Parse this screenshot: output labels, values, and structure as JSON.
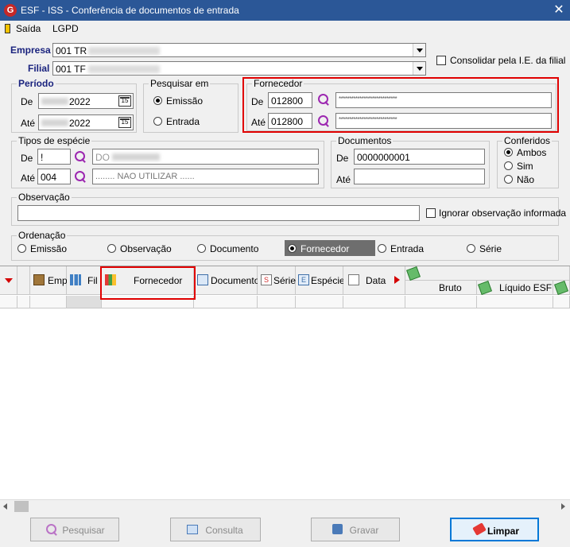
{
  "window": {
    "title": "ESF - ISS - Conferência de documentos de entrada",
    "icon_letter": "G",
    "close": "✕"
  },
  "menu": {
    "items": [
      "Saída",
      "LGPD"
    ]
  },
  "empresa": {
    "label": "Empresa",
    "value": "001 TR"
  },
  "filial": {
    "label": "Filial",
    "value": "001 TF"
  },
  "consolidar": {
    "label": "Consolidar pela I.E. da filial",
    "checked": false
  },
  "periodo": {
    "title": "Período",
    "de_label": "De",
    "ate_label": "Até",
    "de_value": "2022",
    "ate_value": "2022",
    "cal_icon": "15"
  },
  "pesquisar_em": {
    "title": "Pesquisar em",
    "options": [
      "Emissão",
      "Entrada"
    ],
    "selected": "Emissão"
  },
  "fornecedor": {
    "title": "Fornecedor",
    "de_label": "De",
    "ate_label": "Até",
    "de_code": "012800",
    "ate_code": "012800",
    "de_name": "****************************",
    "ate_name": "****************************"
  },
  "tipos_especie": {
    "title": "Tipos de espécie",
    "de_label": "De",
    "ate_label": "Até",
    "de_code": "!",
    "ate_code": "004",
    "de_desc": "DO",
    "ate_desc": "........ NAO UTILIZAR ......"
  },
  "documentos": {
    "title": "Documentos",
    "de_label": "De",
    "ate_label": "Até",
    "de_value": "0000000001",
    "ate_value": ""
  },
  "conferidos": {
    "title": "Conferidos",
    "options": [
      "Ambos",
      "Sim",
      "Não"
    ],
    "selected": "Ambos"
  },
  "observacao": {
    "title": "Observação",
    "value": "",
    "ignore_label": "Ignorar observação informada",
    "ignore_checked": false
  },
  "ordenacao": {
    "title": "Ordenação",
    "options": [
      "Emissão",
      "Observação",
      "Documento",
      "Fornecedor",
      "Entrada",
      "Série"
    ],
    "selected": "Fornecedor"
  },
  "grid": {
    "columns": [
      "Emp",
      "Fil",
      "Fornecedor",
      "Documento",
      "Série",
      "Espécie",
      "Data"
    ],
    "sub_columns": [
      "Bruto",
      "Líquido ESF"
    ]
  },
  "buttons": {
    "pesquisar": "Pesquisar",
    "consulta": "Consulta",
    "gravar": "Gravar",
    "limpar": "Limpar"
  },
  "colors": {
    "title_bar": "#2b5797",
    "highlight": "#e00000",
    "label_blue": "#1a237e"
  }
}
